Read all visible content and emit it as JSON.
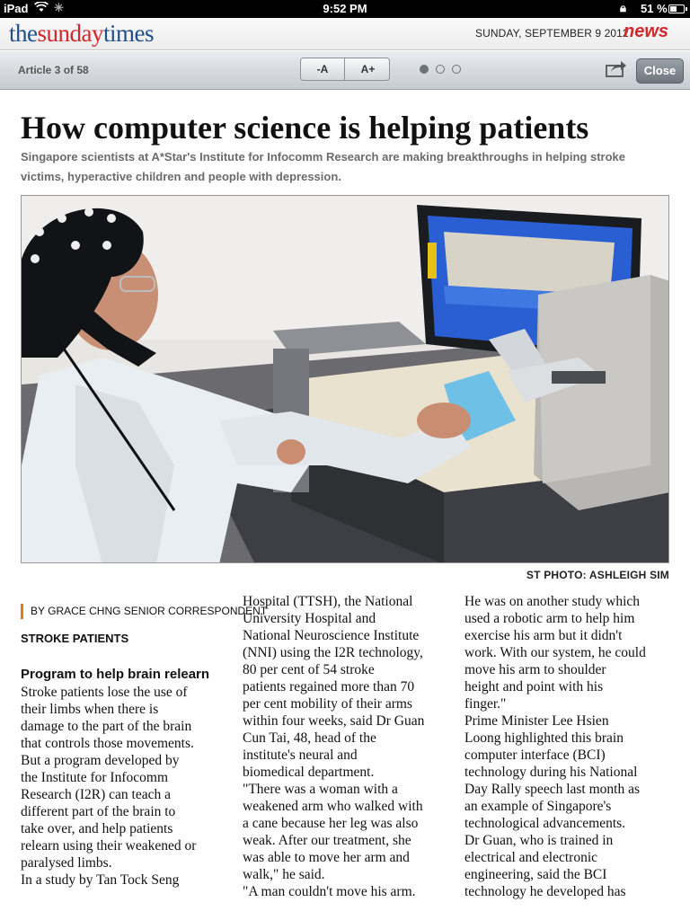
{
  "status_bar": {
    "device": "iPad",
    "time": "9:52 PM",
    "battery": "51 %",
    "battery_level": 0.51
  },
  "masthead": {
    "logo_the": "the",
    "logo_sunday": "sunday",
    "logo_times": "times",
    "date": "SUNDAY, SEPTEMBER 9 2012",
    "section": "news"
  },
  "toolbar": {
    "article_position": "Article 3 of 58",
    "font_smaller": "-A",
    "font_larger": "A+",
    "close_label": "Close",
    "page_dots": 3,
    "active_dot": 0
  },
  "article": {
    "headline": "How computer science is helping patients",
    "subhead": "Singapore scientists at A*Star's Institute for Infocomm Research are making breakthroughs in helping stroke victims, hyperactive children and people with depression.",
    "photo_credit": "ST PHOTO: ASHLEIGH SIM",
    "byline": "BY GRACE CHNG SENIOR CORRESPONDENT",
    "kicker": "STROKE PATIENTS",
    "subtitle": "Program to help brain relearn",
    "col1": " Stroke patients lose the use of\ntheir limbs when there is\ndamage to the part of the brain\nthat controls those movements.\n But a program developed by\nthe Institute for Infocomm\nResearch (I2R) can teach a\ndifferent part of the brain to\ntake over, and help patients\nrelearn using their weakened or\nparalysed limbs.\n In a study by Tan Tock Seng",
    "col2": "Hospital (TTSH), the National\nUniversity Hospital and\nNational Neuroscience Institute\n(NNI) using the I2R technology,\n80 per cent of 54 stroke\npatients regained more than 70\nper cent mobility of their arms\nwithin four weeks, said Dr Guan\nCun Tai, 48, head of the\ninstitute's neural and\nbiomedical department.\n\"There was a woman with a\nweakened arm who walked with\na cane because her leg was also\nweak. After our treatment, she\nwas able to move her arm and\nwalk,\" he said.\n\"A man couldn't move his arm.",
    "col3": "He was on another study which\nused a robotic arm to help him\nexercise his arm but it didn't\nwork. With our system, he could\nmove his arm to shoulder\nheight and point with his\nfinger.\"\n Prime Minister Lee Hsien\nLoong highlighted this brain\ncomputer interface (BCI)\ntechnology during his National\nDay Rally speech last month as\nan example of Singapore's\ntechnological advancements.\n Dr Guan, who is trained in\nelectrical and electronic\nengineering, said the BCI\ntechnology he developed has"
  }
}
